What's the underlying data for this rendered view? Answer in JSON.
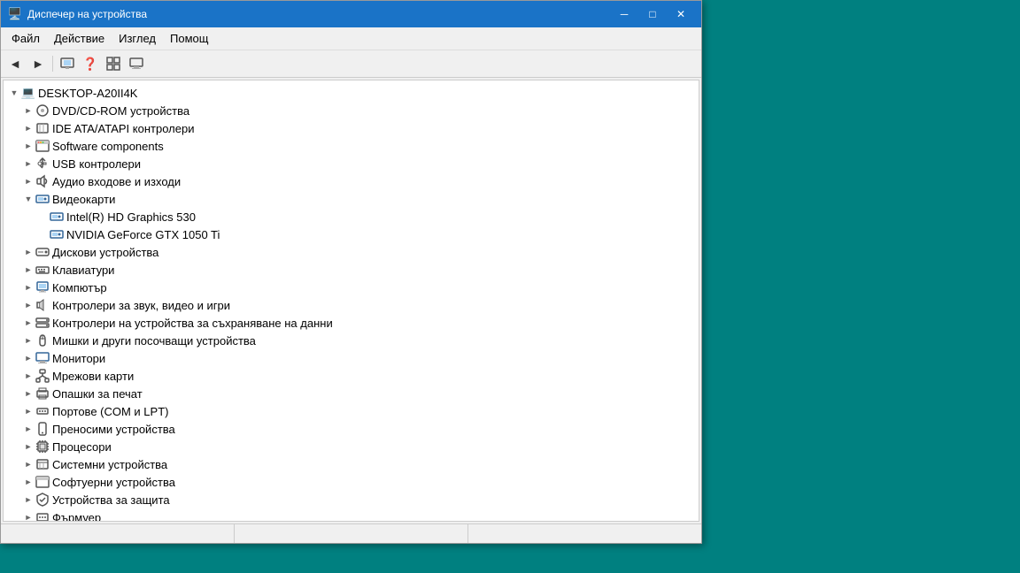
{
  "window": {
    "title": "Диспечер на устройства",
    "title_icon": "🖥️"
  },
  "titlebar_controls": {
    "minimize": "─",
    "maximize": "□",
    "close": "✕"
  },
  "menubar": {
    "items": [
      {
        "label": "Файл"
      },
      {
        "label": "Действие"
      },
      {
        "label": "Изглед"
      },
      {
        "label": "Помощ"
      }
    ]
  },
  "toolbar": {
    "buttons": [
      {
        "icon": "◄",
        "label": "back",
        "disabled": false
      },
      {
        "icon": "►",
        "label": "forward",
        "disabled": false
      },
      {
        "icon": "▣",
        "label": "show-devices",
        "disabled": false
      },
      {
        "icon": "❓",
        "label": "help",
        "disabled": false
      },
      {
        "icon": "▣",
        "label": "view",
        "disabled": false
      },
      {
        "icon": "🖥",
        "label": "monitor",
        "disabled": false
      }
    ]
  },
  "tree": {
    "items": [
      {
        "id": "root",
        "indent": "indent-1",
        "chevron": "open",
        "icon": "💻",
        "icon_class": "icon-computer",
        "label": "DESKTOP-A20II4K",
        "level": 0
      },
      {
        "id": "dvd",
        "indent": "indent-2",
        "chevron": "closed",
        "icon": "📀",
        "icon_class": "icon-disk",
        "label": "DVD/CD-ROM устройства",
        "level": 1
      },
      {
        "id": "ide",
        "indent": "indent-2",
        "chevron": "closed",
        "icon": "🔌",
        "icon_class": "icon-chip",
        "label": "IDE ATA/ATAPI контролери",
        "level": 1
      },
      {
        "id": "software",
        "indent": "indent-2",
        "chevron": "closed",
        "icon": "⚙",
        "icon_class": "icon-software",
        "label": "Software components",
        "level": 1
      },
      {
        "id": "usb",
        "indent": "indent-2",
        "chevron": "closed",
        "icon": "🔌",
        "icon_class": "icon-usb",
        "label": "USB контролери",
        "level": 1
      },
      {
        "id": "audio",
        "indent": "indent-2",
        "chevron": "closed",
        "icon": "🔊",
        "icon_class": "icon-audio",
        "label": "Аудио входове и изходи",
        "level": 1
      },
      {
        "id": "video",
        "indent": "indent-2",
        "chevron": "open",
        "icon": "🖵",
        "icon_class": "icon-video",
        "label": "Видеокарти",
        "level": 1
      },
      {
        "id": "intel_gpu",
        "indent": "indent-3",
        "chevron": "empty",
        "icon": "🖵",
        "icon_class": "icon-gpu",
        "label": "Intel(R) HD Graphics 530",
        "level": 2
      },
      {
        "id": "nvidia_gpu",
        "indent": "indent-3",
        "chevron": "empty",
        "icon": "🖵",
        "icon_class": "icon-gpu",
        "label": "NVIDIA GeForce GTX 1050 Ti",
        "level": 2
      },
      {
        "id": "disk",
        "indent": "indent-2",
        "chevron": "closed",
        "icon": "💾",
        "icon_class": "icon-disk",
        "label": "Дискови устройства",
        "level": 1
      },
      {
        "id": "keyboard",
        "indent": "indent-2",
        "chevron": "closed",
        "icon": "⌨",
        "icon_class": "icon-keyboard",
        "label": "Клавиатури",
        "level": 1
      },
      {
        "id": "computer",
        "indent": "indent-2",
        "chevron": "closed",
        "icon": "🖥",
        "icon_class": "icon-pc",
        "label": "Компютър",
        "level": 1
      },
      {
        "id": "sound_ctrl",
        "indent": "indent-2",
        "chevron": "closed",
        "icon": "🎵",
        "icon_class": "icon-sound",
        "label": "Контролери за звук, видео и игри",
        "level": 1
      },
      {
        "id": "storage_ctrl",
        "indent": "indent-2",
        "chevron": "closed",
        "icon": "💾",
        "icon_class": "icon-storage",
        "label": "Контролери на устройства за съхраняване на данни",
        "level": 1
      },
      {
        "id": "mouse",
        "indent": "indent-2",
        "chevron": "closed",
        "icon": "🖱",
        "icon_class": "icon-mouse",
        "label": "Мишки и други посочващи устройства",
        "level": 1
      },
      {
        "id": "monitors",
        "indent": "indent-2",
        "chevron": "closed",
        "icon": "🖥",
        "icon_class": "icon-display",
        "label": "Монитори",
        "level": 1
      },
      {
        "id": "network",
        "indent": "indent-2",
        "chevron": "closed",
        "icon": "🌐",
        "icon_class": "icon-network",
        "label": "Мрежови карти",
        "level": 1
      },
      {
        "id": "printers",
        "indent": "indent-2",
        "chevron": "closed",
        "icon": "🖨",
        "icon_class": "icon-printer",
        "label": "Опашки за печат",
        "level": 1
      },
      {
        "id": "ports",
        "indent": "indent-2",
        "chevron": "closed",
        "icon": "🔌",
        "icon_class": "icon-port",
        "label": "Портове (COM и LPT)",
        "level": 1
      },
      {
        "id": "portable",
        "indent": "indent-2",
        "chevron": "closed",
        "icon": "📱",
        "icon_class": "icon-portable",
        "label": "Преносими устройства",
        "level": 1
      },
      {
        "id": "processors",
        "indent": "indent-2",
        "chevron": "closed",
        "icon": "⚙",
        "icon_class": "icon-cpu",
        "label": "Процесори",
        "level": 1
      },
      {
        "id": "system_dev",
        "indent": "indent-2",
        "chevron": "closed",
        "icon": "⚙",
        "icon_class": "icon-system",
        "label": "Системни устройства",
        "level": 1
      },
      {
        "id": "software_dev",
        "indent": "indent-2",
        "chevron": "closed",
        "icon": "⚙",
        "icon_class": "icon-software",
        "label": "Софтуерни устройства",
        "level": 1
      },
      {
        "id": "security",
        "indent": "indent-2",
        "chevron": "closed",
        "icon": "🔒",
        "icon_class": "icon-security",
        "label": "Устройства за защита",
        "level": 1
      },
      {
        "id": "firmware",
        "indent": "indent-2",
        "chevron": "closed",
        "icon": "⚡",
        "icon_class": "icon-firmware",
        "label": "Фърмуер",
        "level": 1
      }
    ]
  },
  "statusbar": {
    "sections": [
      "",
      "",
      ""
    ]
  }
}
